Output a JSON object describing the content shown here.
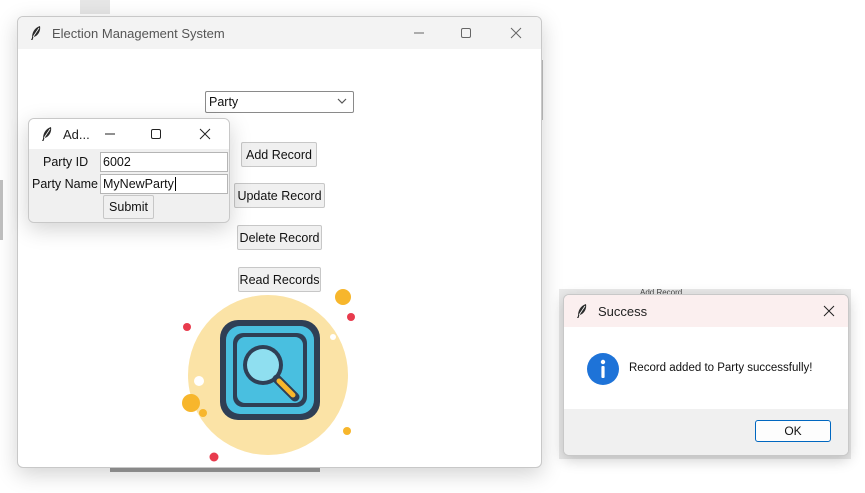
{
  "main_window": {
    "title": "Election Management System",
    "table_select": {
      "value": "Party"
    },
    "buttons": {
      "add": "Add Record",
      "update": "Update Record",
      "delete": "Delete Record",
      "read": "Read Records"
    },
    "illustration_icon": "magnifier-search-icon"
  },
  "add_dialog": {
    "title": "Ad...",
    "fields": {
      "party_id_label": "Party ID",
      "party_id_value": "6002",
      "party_name_label": "Party Name",
      "party_name_value": "MyNewParty"
    },
    "submit_label": "Submit"
  },
  "success_dialog": {
    "title": "Success",
    "message": "Record added to Party successfully!",
    "ok_label": "OK",
    "icon": "info-icon",
    "behind_text": "Add Record"
  },
  "colors": {
    "accent": "#0067c0",
    "info_blue": "#1e73d8",
    "illustration_bg": "#fbe3a6",
    "illustration_tile": "#49bfe0",
    "illustration_yellow": "#f7b62c",
    "illustration_red": "#e83b4d"
  }
}
